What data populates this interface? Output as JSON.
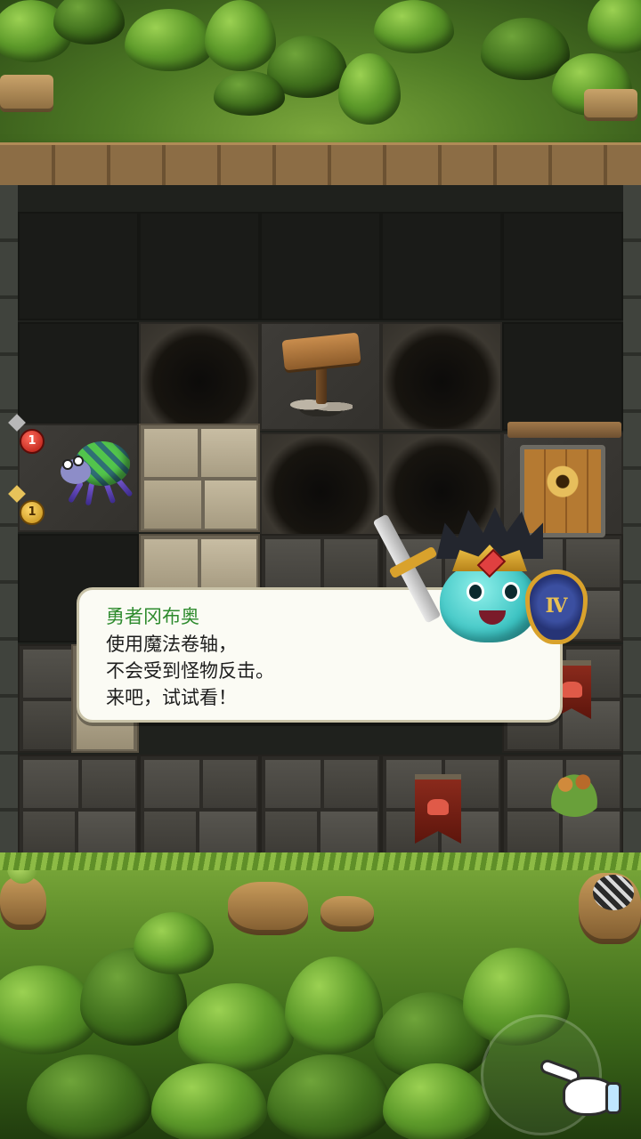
{
  "dialog": {
    "speaker": "勇者冈布奥",
    "lines": [
      "使用魔法卷轴，",
      "不会受到怪物反击。",
      "来吧，试试看！"
    ]
  },
  "enemy": {
    "name": "spider",
    "attack": "1",
    "reward": "1"
  },
  "hero": {
    "shield_emblem": "Ⅳ"
  },
  "colors": {
    "speaker_name": "#2e8b2e",
    "dialog_bg": "#fbfbf4",
    "attack_badge": "#c0211a",
    "gold_badge": "#d9a22c"
  },
  "icons": [
    "sword-stat-icon",
    "coin-stat-icon",
    "keyhole-icon",
    "tutorial-hand-icon"
  ]
}
